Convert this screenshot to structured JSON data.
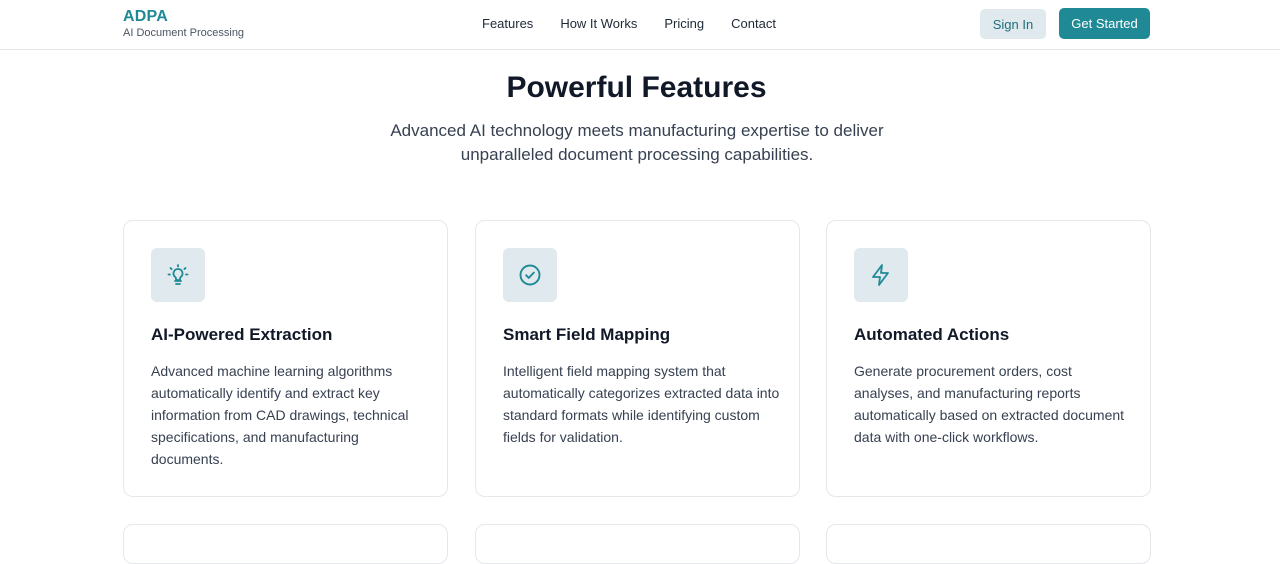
{
  "brand": {
    "name": "ADPA",
    "tagline": "AI Document Processing"
  },
  "nav": {
    "links": [
      "Features",
      "How It Works",
      "Pricing",
      "Contact"
    ],
    "sign_in": "Sign In",
    "get_started": "Get Started"
  },
  "section": {
    "title": "Powerful Features",
    "subtitle": "Advanced AI technology meets manufacturing expertise to deliver unparalleled document processing capabilities."
  },
  "features": [
    {
      "icon": "lightbulb-icon",
      "title": "AI-Powered Extraction",
      "description": "Advanced machine learning algorithms automatically identify and extract key information from CAD drawings, technical specifications, and manufacturing documents."
    },
    {
      "icon": "check-circle-icon",
      "title": "Smart Field Mapping",
      "description": "Intelligent field mapping system that automatically categorizes extracted data into standard formats while identifying custom fields for validation."
    },
    {
      "icon": "lightning-icon",
      "title": "Automated Actions",
      "description": "Generate procurement orders, cost analyses, and manufacturing reports automatically based on extracted document data with one-click workflows."
    }
  ],
  "colors": {
    "accent": "#1f8a96",
    "icon_bg": "#dfe9ee",
    "border": "#e5e7eb"
  }
}
